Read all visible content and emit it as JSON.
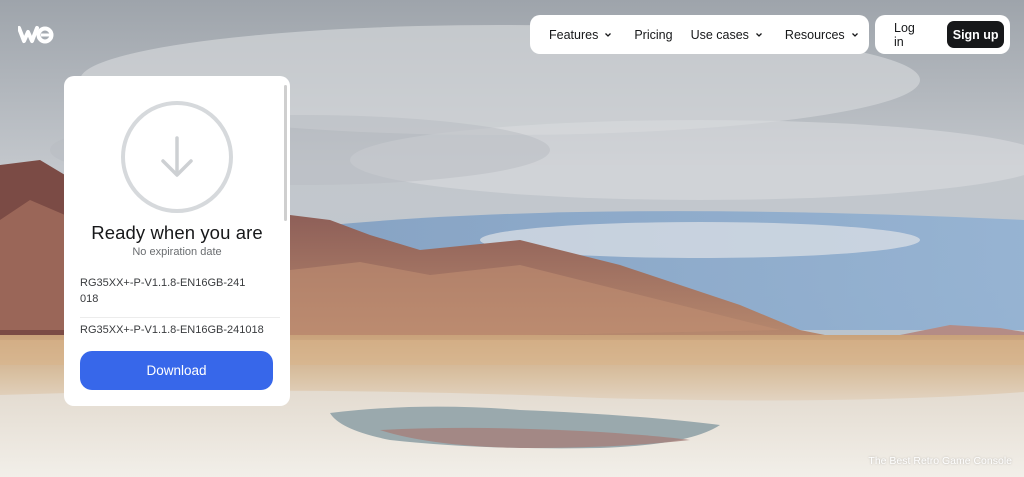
{
  "logo": {
    "icon": "wetransfer-logo"
  },
  "nav": {
    "items": [
      {
        "label": "Features",
        "has_dropdown": true
      },
      {
        "label": "Pricing",
        "has_dropdown": false
      },
      {
        "label": "Use cases",
        "has_dropdown": true
      },
      {
        "label": "Resources",
        "has_dropdown": true
      }
    ],
    "login_label": "Log in",
    "signup_label": "Sign up"
  },
  "card": {
    "icon": "download-arrow-icon",
    "title": "Ready when you are",
    "subtitle": "No expiration date",
    "files": [
      "RG35XX+-P-V1.1.8-EN16GB-241018",
      "RG35XX+-P-V1.1.8-EN16GB-241018"
    ],
    "download_label": "Download"
  },
  "background": {
    "caption": "The Best Retro Game Console"
  },
  "colors": {
    "accent": "#3767ea",
    "dark": "#17181a",
    "white": "#ffffff"
  }
}
